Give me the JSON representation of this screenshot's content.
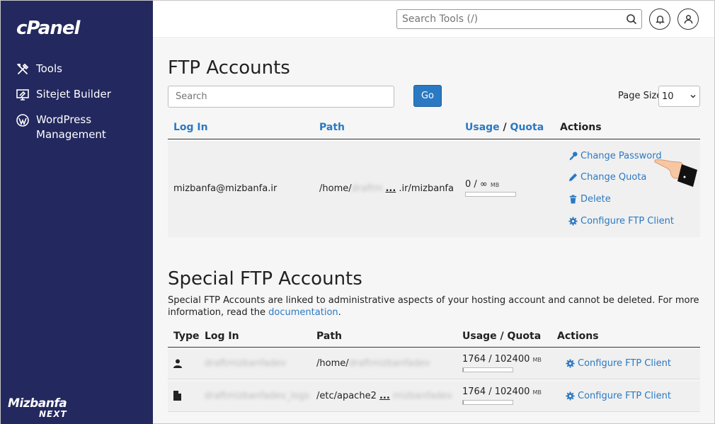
{
  "sidebar": {
    "logo": "cPanel",
    "items": [
      {
        "label": "Tools",
        "icon": "tools-icon"
      },
      {
        "label": "Sitejet Builder",
        "icon": "monitor-icon"
      },
      {
        "label": "WordPress Management",
        "icon": "wordpress-icon"
      }
    ],
    "brand_line1": "Mizbanfa",
    "brand_line2": "NEXT"
  },
  "topbar": {
    "search_placeholder": "Search Tools (/)"
  },
  "ftp": {
    "title": "FTP Accounts",
    "search_placeholder": "Search",
    "go_label": "Go",
    "page_size_label": "Page Size",
    "page_size_value": "10",
    "headers": {
      "login": "Log In",
      "path": "Path",
      "usage": "Usage",
      "slash": "/",
      "quota": "Quota",
      "actions": "Actions"
    },
    "row": {
      "login": "mizbanfa@mizbanfa.ir",
      "path_prefix": "/home/",
      "path_blur": "draftm",
      "path_dots": "...",
      "path_suffix": ".ir/mizbanfa",
      "usage": "0 / ∞",
      "unit": "MB",
      "usage_fraction": 0
    },
    "actions": {
      "change_password": "Change Password",
      "change_quota": "Change Quota",
      "delete": "Delete",
      "configure": "Configure FTP Client"
    }
  },
  "special": {
    "title": "Special FTP Accounts",
    "desc_text": "Special FTP Accounts are linked to administrative aspects of your hosting account and cannot be deleted. For more information, read the ",
    "desc_link": "documentation",
    "desc_end": ".",
    "headers": {
      "type": "Type",
      "login": "Log In",
      "path": "Path",
      "usage": "Usage / Quota",
      "actions": "Actions"
    },
    "rows": [
      {
        "type_icon": "user-icon",
        "login_blur": "draftmizbanfadev",
        "path_prefix": "/home/",
        "path_blur": "draftmizbanfadev",
        "path_dots": "",
        "path_suffix": "",
        "usage": "1764 / 102400",
        "unit": "MB",
        "usage_fraction": 0.02,
        "action": "Configure FTP Client"
      },
      {
        "type_icon": "file-icon",
        "login_blur": "draftmizbanfadev_logs",
        "path_prefix": "/etc/apache2",
        "path_blur": "",
        "path_dots": "...",
        "path_suffix": "mizbanfadev",
        "usage": "1764 / 102400",
        "unit": "MB",
        "usage_fraction": 0.02,
        "action": "Configure FTP Client"
      }
    ]
  },
  "colors": {
    "sidebar": "#23285e",
    "link": "#2b79c2",
    "go": "#2b79c2",
    "bar": "#5cb85c"
  }
}
